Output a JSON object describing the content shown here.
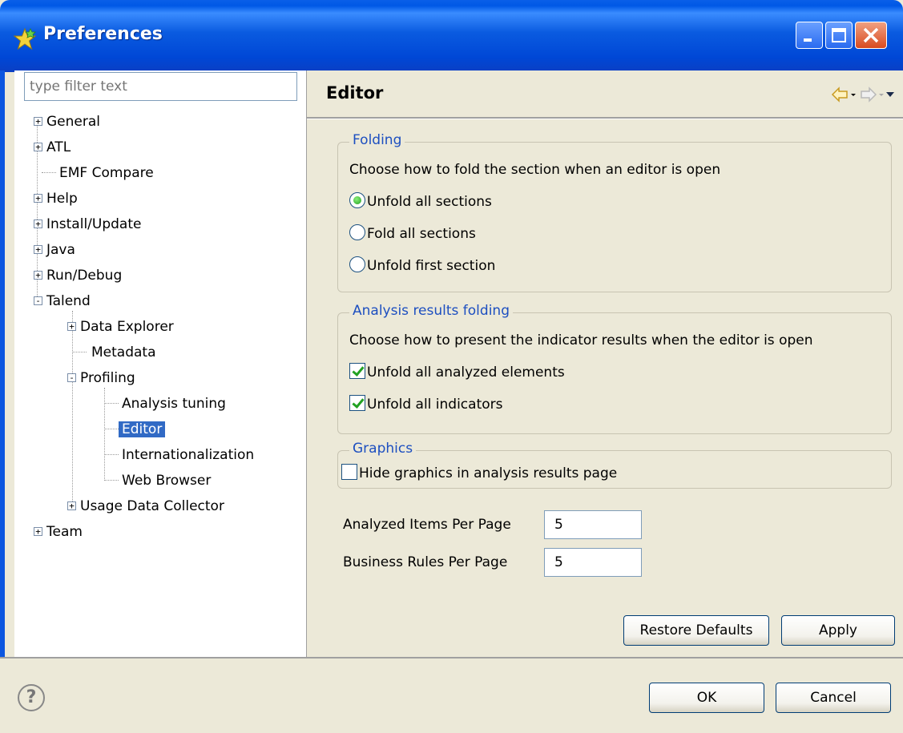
{
  "window": {
    "title": "Preferences",
    "icon": "star-icon"
  },
  "filter": {
    "placeholder": "type filter text",
    "value": ""
  },
  "tree": {
    "items": [
      {
        "label": "General",
        "expander": "+"
      },
      {
        "label": "ATL",
        "expander": "+"
      },
      {
        "label": "EMF Compare"
      },
      {
        "label": "Help",
        "expander": "+"
      },
      {
        "label": "Install/Update",
        "expander": "+"
      },
      {
        "label": "Java",
        "expander": "+"
      },
      {
        "label": "Run/Debug",
        "expander": "+"
      },
      {
        "label": "Talend",
        "expander": "-"
      },
      {
        "label": "Data Explorer",
        "expander": "+"
      },
      {
        "label": "Metadata"
      },
      {
        "label": "Profiling",
        "expander": "-"
      },
      {
        "label": "Analysis tuning"
      },
      {
        "label": "Editor",
        "selected": true
      },
      {
        "label": "Internationalization"
      },
      {
        "label": "Web Browser"
      },
      {
        "label": "Usage Data Collector",
        "expander": "+"
      },
      {
        "label": "Team",
        "expander": "+"
      }
    ]
  },
  "editor": {
    "title": "Editor",
    "folding": {
      "legend": "Folding",
      "description": "Choose how to fold the section when an editor is open",
      "options": [
        {
          "label": "Unfold all sections",
          "selected": true
        },
        {
          "label": "Fold all sections",
          "selected": false
        },
        {
          "label": "Unfold first section",
          "selected": false
        }
      ]
    },
    "analysis_folding": {
      "legend": "Analysis results folding",
      "description": "Choose how to present the indicator results when the editor is open",
      "options": [
        {
          "label": "Unfold all analyzed elements",
          "checked": true
        },
        {
          "label": "Unfold all indicators",
          "checked": true
        }
      ]
    },
    "graphics": {
      "legend": "Graphics",
      "option": {
        "label": "Hide graphics in analysis results page",
        "checked": false
      }
    },
    "analyzed_items": {
      "label": "Analyzed Items Per Page",
      "value": "5"
    },
    "business_rules": {
      "label": "Business Rules Per Page",
      "value": "5"
    },
    "restore_defaults": "Restore Defaults",
    "apply": "Apply"
  },
  "footer": {
    "ok": "OK",
    "cancel": "Cancel",
    "help_glyph": "?"
  },
  "colors": {
    "titlebar": "#0058e6",
    "selection": "#316ac5",
    "group_legend": "#1d4fc0",
    "radio_check": "#21a121"
  }
}
